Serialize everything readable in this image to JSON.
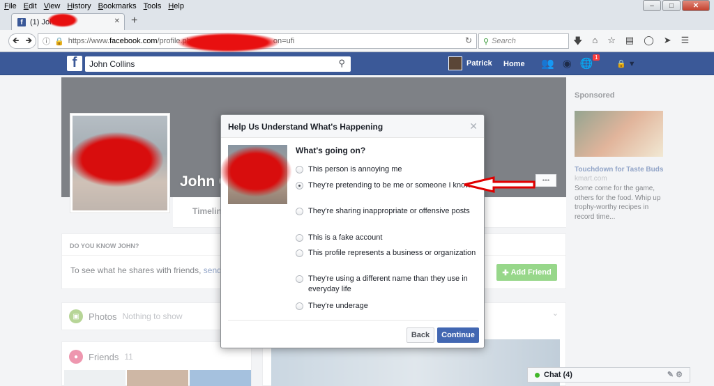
{
  "browser": {
    "menu": [
      "File",
      "Edit",
      "View",
      "History",
      "Bookmarks",
      "Tools",
      "Help"
    ],
    "tab_title": "(1) John",
    "url_prefix": "https://www.",
    "url_domain": "facebook.com",
    "url_path": "/profile.php",
    "url_suffix": "on=ufi",
    "search_placeholder": "Search"
  },
  "facebook": {
    "search_value": "John Collins",
    "user_name": "Patrick",
    "home_label": "Home",
    "notification_count": "1"
  },
  "profile": {
    "name": "John C",
    "timeline_tab": "Timeline",
    "more_label": "•••",
    "know_title": "DO YOU KNOW JOHN?",
    "know_text": "To see what he shares with friends, ",
    "know_link": "send h",
    "add_friend": "Add Friend",
    "photos_label": "Photos",
    "photos_empty": "Nothing to show",
    "friends_label": "Friends",
    "friends_count": "11"
  },
  "sponsored": {
    "label": "Sponsored",
    "ad_title": "Touchdown for Taste Buds",
    "ad_domain": "kmart.com",
    "ad_text": "Some come for the game, others for the food. Whip up trophy-worthy recipes in record time..."
  },
  "dialog": {
    "title": "Help Us Understand What's Happening",
    "question": "What's going on?",
    "options": [
      "This person is annoying me",
      "They're pretending to be me or someone I know",
      "They're sharing inappropriate or offensive posts",
      "This is a fake account",
      "This profile represents a business or organization",
      "They're using a different name than they use in everyday life",
      "They're underage"
    ],
    "selected_index": 1,
    "back_label": "Back",
    "continue_label": "Continue"
  },
  "chat": {
    "label": "Chat (4)"
  },
  "colors": {
    "fb_blue": "#3b5998",
    "button_blue": "#4267b2",
    "add_friend_green": "#42b72a",
    "annotation_red": "#e00000"
  }
}
